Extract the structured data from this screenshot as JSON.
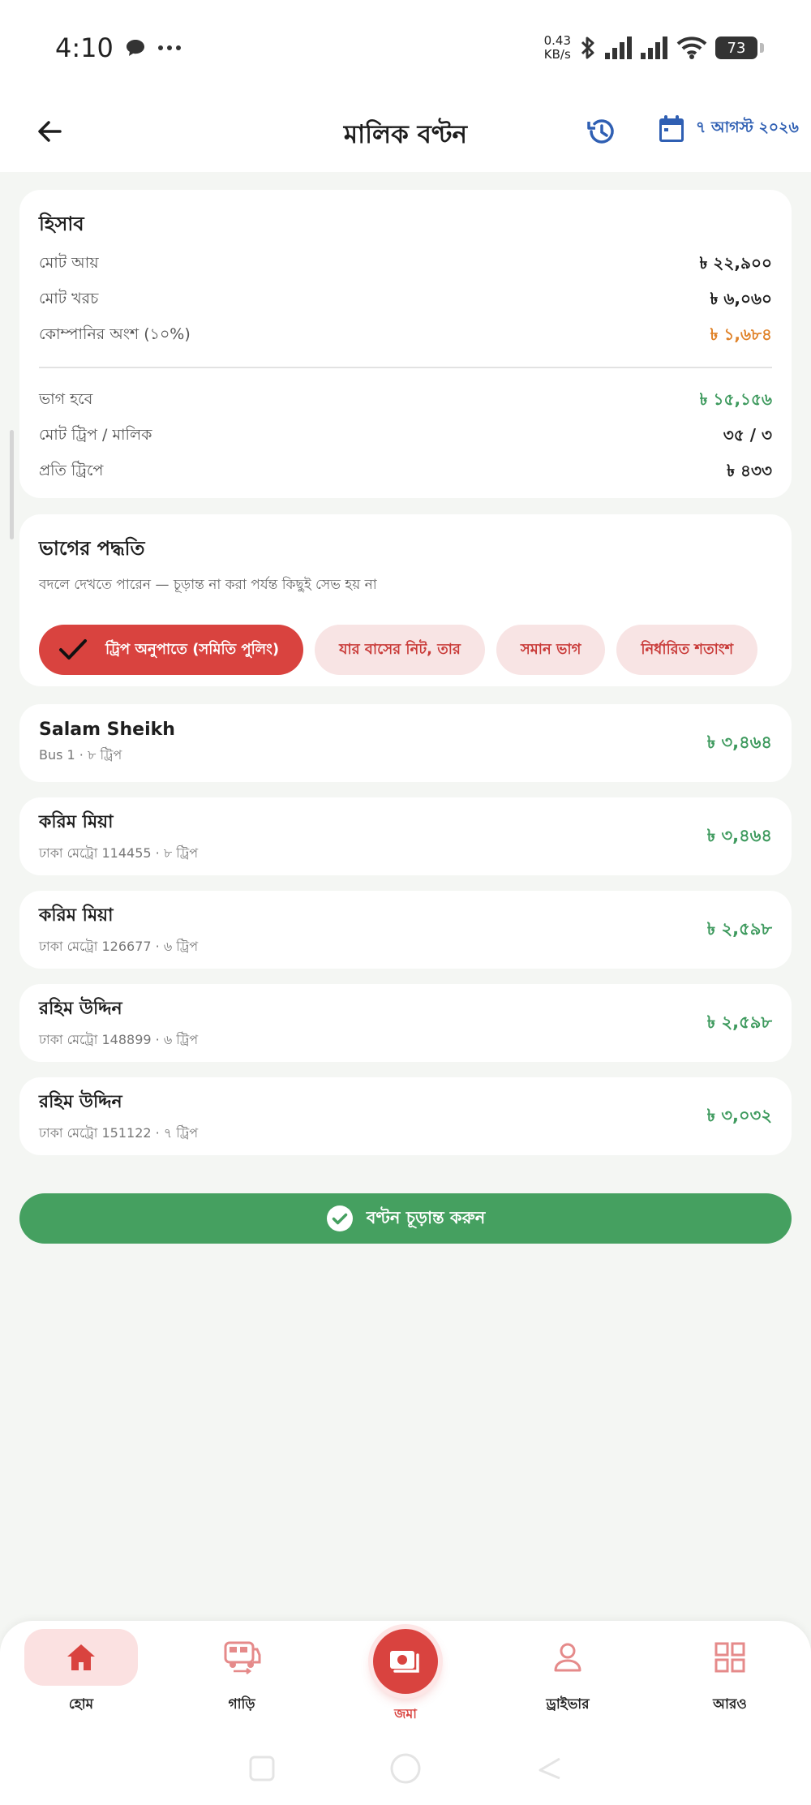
{
  "status_bar": {
    "time": "4:10",
    "net_speed_value": "0.43",
    "net_speed_unit": "KB/s",
    "battery": "73"
  },
  "app_bar": {
    "title": "মালিক বণ্টন",
    "date": "৭ আগস্ট ২০২৬"
  },
  "summary": {
    "title": "হিসাব",
    "rows_top": [
      {
        "label": "মোট আয়",
        "value": "৳ ২২,৯০০",
        "tone": "normal"
      },
      {
        "label": "মোট খরচ",
        "value": "৳ ৬,০৬০",
        "tone": "normal"
      },
      {
        "label": "কোম্পানির অংশ (১০%)",
        "value": "৳ ১,৬৮৪",
        "tone": "orange"
      }
    ],
    "rows_bottom": [
      {
        "label": "ভাগ হবে",
        "value": "৳ ১৫,১৫৬",
        "tone": "green"
      },
      {
        "label": "মোট ট্রিপ / মালিক",
        "value": "৩৫ / ৩",
        "tone": "normal"
      },
      {
        "label": "প্রতি ট্রিপে",
        "value": "৳ ৪৩৩",
        "tone": "normal"
      }
    ]
  },
  "method": {
    "title": "ভাগের পদ্ধতি",
    "subtitle": "বদলে দেখতে পারেন — চূড়ান্ত না করা পর্যন্ত কিছুই সেভ হয় না",
    "options": [
      {
        "label": "ট্রিপ অনুপাতে (সমিতি পুলিং)",
        "active": true
      },
      {
        "label": "যার বাসের নিট, তার",
        "active": false
      },
      {
        "label": "সমান ভাগ",
        "active": false
      },
      {
        "label": "নির্ধারিত শতাংশ",
        "active": false
      }
    ]
  },
  "owners": [
    {
      "name": "Salam Sheikh",
      "meta": "Bus 1 · ৮ ট্রিপ",
      "amount": "৳ ৩,৪৬৪"
    },
    {
      "name": "করিম মিয়া",
      "meta": "ঢাকা মেট্রো 114455 · ৮ ট্রিপ",
      "amount": "৳ ৩,৪৬৪"
    },
    {
      "name": "করিম মিয়া",
      "meta": "ঢাকা মেট্রো 126677 · ৬ ট্রিপ",
      "amount": "৳ ২,৫৯৮"
    },
    {
      "name": "রহিম উদ্দিন",
      "meta": "ঢাকা মেট্রো 148899 · ৬ ট্রিপ",
      "amount": "৳ ২,৫৯৮"
    },
    {
      "name": "রহিম উদ্দিন",
      "meta": "ঢাকা মেট্রো 151122 · ৭ ট্রিপ",
      "amount": "৳ ৩,০৩২"
    }
  ],
  "confirm_button": {
    "label": "বণ্টন চূড়ান্ত করুন"
  },
  "bottom_nav": {
    "items": [
      {
        "label": "হোম",
        "icon": "home-icon",
        "active": true
      },
      {
        "label": "গাড়ি",
        "icon": "bus-icon",
        "active": false
      },
      {
        "label": "জমা",
        "icon": "cash-icon",
        "active": false
      },
      {
        "label": "ড্রাইভার",
        "icon": "person-icon",
        "active": false
      },
      {
        "label": "আরও",
        "icon": "grid-icon",
        "active": false
      }
    ]
  },
  "colors": {
    "primary_red": "#d9433f",
    "green": "#45a060",
    "orange": "#e0832a",
    "blue": "#2f5fb3"
  }
}
